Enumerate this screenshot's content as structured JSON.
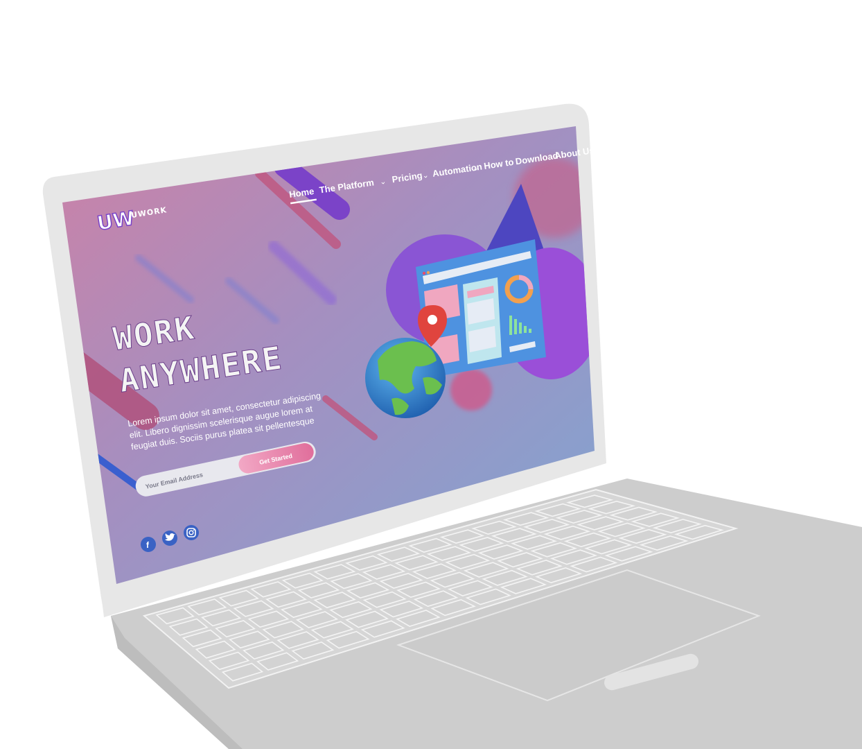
{
  "brand": {
    "name": "UWORK",
    "mark": "UW"
  },
  "nav": {
    "items": [
      {
        "label": "Home",
        "active": true,
        "dropdown": false
      },
      {
        "label": "The Platform",
        "dropdown": true
      },
      {
        "label": "Pricing",
        "dropdown": true
      },
      {
        "label": "Automation",
        "dropdown": true
      },
      {
        "label": "How to",
        "dropdown": false
      },
      {
        "label": "Download",
        "dropdown": false
      },
      {
        "label": "About Us",
        "dropdown": false
      }
    ]
  },
  "hero": {
    "title_line1": "WORK",
    "title_line2": "ANYWHERE",
    "body_line1": "Lorem ipsum dolor sit amet, consectetur adipiscing",
    "body_line2": "elit. Libero dignissim scelerisque augue lorem at",
    "body_line3": "feugiat duis. Sociis purus platea sit pellentesque"
  },
  "signup": {
    "placeholder": "Your Email Address",
    "button_label": "Get Started"
  },
  "social": [
    {
      "icon": "facebook-icon",
      "glyph": "f"
    },
    {
      "icon": "twitter-icon"
    },
    {
      "icon": "instagram-icon"
    }
  ],
  "colors": {
    "accent_pink": "#e7769f",
    "accent_purple": "#7a43c8",
    "social_blue": "#3a62c4",
    "screen_gradient_start": "#cf7da4",
    "screen_gradient_end": "#7fa5cf"
  }
}
